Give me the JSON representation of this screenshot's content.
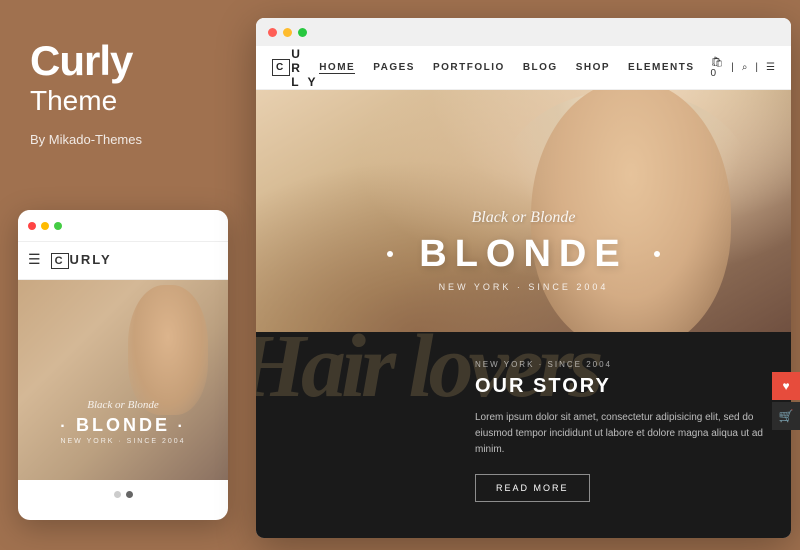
{
  "left": {
    "brand": "Curly",
    "subtitle": "Theme",
    "by": "By Mikado-Themes"
  },
  "mobile": {
    "dots": [
      "red",
      "yellow",
      "green"
    ],
    "logo_box": "C",
    "logo_text": "URLY",
    "script_text": "Black or Blonde",
    "blonde_text": "BLONDE",
    "since_text": "NEW YORK · SINCE 2004",
    "indicators": [
      "inactive",
      "active"
    ]
  },
  "desktop": {
    "titlebar_dots": [
      "red",
      "yellow",
      "green"
    ],
    "logo_box": "C",
    "logo_rest": "U R L Y",
    "nav_links": [
      "HOME",
      "PAGES",
      "PORTFOLIO",
      "BLOG",
      "SHOP",
      "ELEMENTS"
    ],
    "nav_icons": [
      "bag-icon",
      "search-icon",
      "menu-icon"
    ],
    "nav_active": "HOME",
    "hero": {
      "script": "Black or Blonde",
      "main": "BLONDE",
      "since": "NEW YORK · SINCE 2004"
    },
    "story": {
      "script_bg": "Hair lovers",
      "since": "NEW YORK · SINCE 2004",
      "title": "OUR STORY",
      "body": "Lorem ipsum dolor sit amet, consectetur adipisicing elit, sed do eiusmod tempor incididunt ut labore et dolore magna aliqua ut ad minim.",
      "button": "READ MORE"
    }
  }
}
